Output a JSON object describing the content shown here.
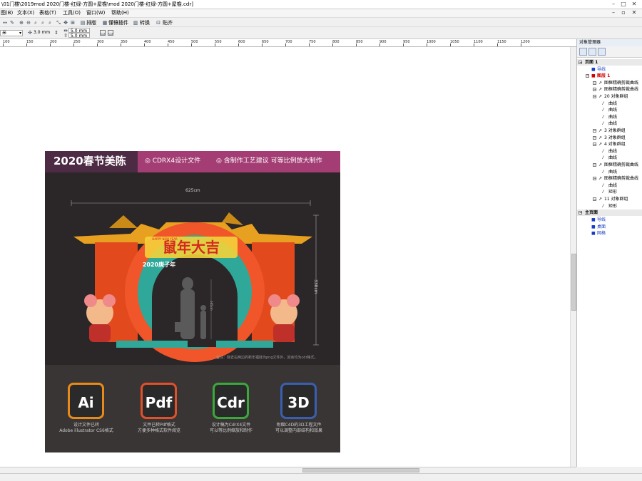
{
  "window": {
    "title": "\\01门楼\\2019mod 2020门楼-红绿-方圆+屋檐\\mod 2020门楼-红绿-方圆+屋檐.cdr]"
  },
  "menu": {
    "items": [
      "图(B)",
      "文本(X)",
      "表格(T)",
      "工具(O)",
      "窗口(W)",
      "帮助(H)"
    ]
  },
  "toolbar": {
    "buttons": [
      "排版",
      "懂镶插件",
      "转换",
      "贴齐"
    ]
  },
  "propbar": {
    "unit": "米",
    "outline_width": "3.0 mm",
    "nudge_x": "5.0 mm",
    "nudge_y": "5.0 mm"
  },
  "ruler": {
    "labels": [
      "100",
      "150",
      "200",
      "250",
      "300",
      "350",
      "400",
      "450",
      "500",
      "550",
      "600",
      "650",
      "700",
      "750",
      "800",
      "850",
      "900",
      "950",
      "1000",
      "1050",
      "1100",
      "1150",
      "1200"
    ]
  },
  "design": {
    "banner_title": "2020春节美陈",
    "banner_tag1": "CDRX4设计文件",
    "banner_tag2": "含制作工艺建议 可等比例放大制作",
    "width_dim": "625cm",
    "height_dim": "338cm",
    "person_dim": "165cm",
    "headline": "鼠年大吉",
    "subheadline": "2020庚子年",
    "happy_new_year": "HAPPY NEW YEAR",
    "note": "备注：除去右两边的新年福娃为png文件外，其余均为cdr格式。",
    "apps": [
      {
        "icon": "Ai",
        "caption1": "设计文件已转",
        "caption2": "Adobe illustrator CS6格式",
        "color": "#e88a1a"
      },
      {
        "icon": "Pdf",
        "caption1": "文件已转Pdf格式",
        "caption2": "方便多种格式软件阅览",
        "color": "#e0502a"
      },
      {
        "icon": "Cdr",
        "caption1": "设计稿为CdrX4文件",
        "caption2": "可以等比例缩放和制作",
        "color": "#3aa83a"
      },
      {
        "icon": "3D",
        "caption1": "附赠C4D的3D工程文件",
        "caption2": "可以调整内部结构和效果",
        "color": "#3a5fb0"
      }
    ]
  },
  "docker": {
    "title": "对象管理器",
    "tree": [
      {
        "label": "页面 1",
        "kind": "page"
      },
      {
        "label": "导线",
        "kind": "layer-blue"
      },
      {
        "label": "图层 1",
        "kind": "layer-red"
      },
      {
        "label": "图框精确剪裁曲线",
        "kind": "item"
      },
      {
        "label": "图框精确剪裁曲线",
        "kind": "item"
      },
      {
        "label": "20 对象群组",
        "kind": "item"
      },
      {
        "label": "曲线",
        "kind": "sub"
      },
      {
        "label": "曲线",
        "kind": "sub"
      },
      {
        "label": "曲线",
        "kind": "sub"
      },
      {
        "label": "曲线",
        "kind": "sub"
      },
      {
        "label": "3 对象群组",
        "kind": "item"
      },
      {
        "label": "3 对象群组",
        "kind": "item"
      },
      {
        "label": "4 对象群组",
        "kind": "item"
      },
      {
        "label": "曲线",
        "kind": "sub"
      },
      {
        "label": "曲线",
        "kind": "sub"
      },
      {
        "label": "图框精确剪裁曲线",
        "kind": "item"
      },
      {
        "label": "曲线",
        "kind": "sub"
      },
      {
        "label": "图框精确剪裁曲线",
        "kind": "item"
      },
      {
        "label": "曲线",
        "kind": "sub"
      },
      {
        "label": "矩形",
        "kind": "sub"
      },
      {
        "label": "11 对象群组",
        "kind": "item"
      },
      {
        "label": "矩形",
        "kind": "sub"
      },
      {
        "label": "主页面",
        "kind": "page"
      },
      {
        "label": "导线",
        "kind": "layer-blue"
      },
      {
        "label": "桌面",
        "kind": "layer-blue"
      },
      {
        "label": "网格",
        "kind": "layer-blue"
      }
    ]
  }
}
